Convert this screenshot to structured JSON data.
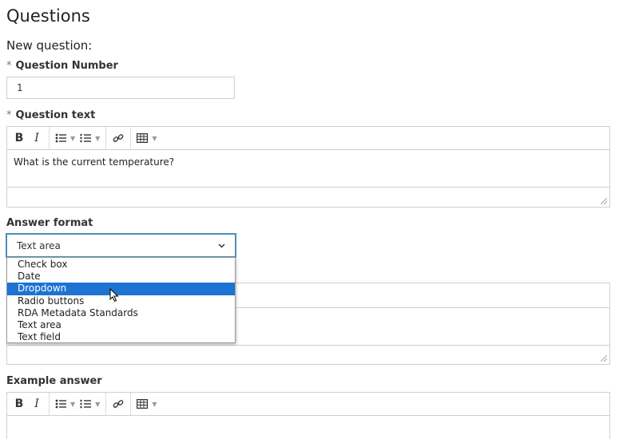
{
  "page": {
    "title": "Questions",
    "subtitle": "New question:"
  },
  "question_number": {
    "required_mark": "*",
    "label": "Question Number",
    "value": "1"
  },
  "question_text": {
    "required_mark": "*",
    "label": "Question text",
    "content": "What is the current temperature?"
  },
  "toolbar": {
    "bold": "B",
    "italic": "I",
    "bullet_list_icon": "bullet-list-icon",
    "numbered_list_icon": "numbered-list-icon",
    "link_icon": "link-icon",
    "table_icon": "table-icon"
  },
  "answer_format": {
    "label": "Answer format",
    "selected": "Text area",
    "options": [
      "Check box",
      "Date",
      "Dropdown",
      "Radio buttons",
      "RDA Metadata Standards",
      "Text area",
      "Text field"
    ],
    "highlighted": "Dropdown"
  },
  "example_answer": {
    "label": "Example answer",
    "content": ""
  },
  "colors": {
    "highlight": "#1e73d2",
    "focus_border": "#4a8fb8",
    "border": "#cfcfcf"
  }
}
